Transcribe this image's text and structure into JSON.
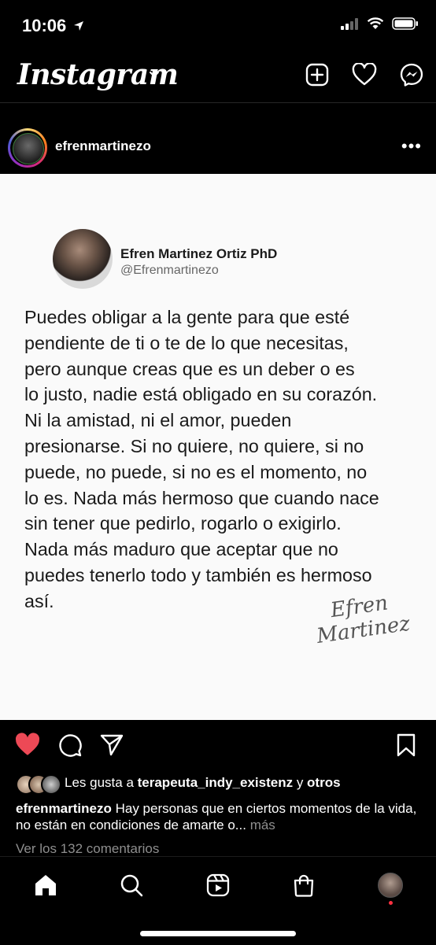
{
  "status": {
    "time": "10:06"
  },
  "topbar": {
    "logo": "Instagram"
  },
  "post": {
    "username": "efrenmartinezo",
    "more": "•••",
    "tweet": {
      "name": "Efren Martinez Ortiz PhD",
      "handle": "@Efrenmartinezo",
      "text": "Puedes obligar a la gente para que esté\npendiente de ti o te de lo que necesitas,\npero aunque creas que es un deber o es\nlo justo, nadie está obligado en su corazón.\nNi la amistad, ni el amor, pueden\npresionarse. Si no quiere, no quiere, si no\npuede, no puede, si no es el momento, no\nlo es. Nada más hermoso que cuando nace\nsin tener que pedirlo, rogarlo o exigirlo.\nNada más maduro que aceptar que no\npuedes tenerlo todo y también es hermoso\nasí.",
      "signature_line1": "Efren",
      "signature_line2": "Martinez"
    },
    "likes": {
      "prefix": "Les gusta a ",
      "user": "terapeuta_indy_existenz",
      "suffix": " y ",
      "others": "otros"
    },
    "caption": {
      "user": "efrenmartinezo",
      "text": " Hay personas que en ciertos momentos de la vida, no están en condiciones de amarte o...",
      "more": " más"
    },
    "view_comments": "Ver los 132 comentarios"
  },
  "colors": {
    "like_red": "#ed4956",
    "background": "#000000",
    "muted": "#8e8e8e"
  }
}
